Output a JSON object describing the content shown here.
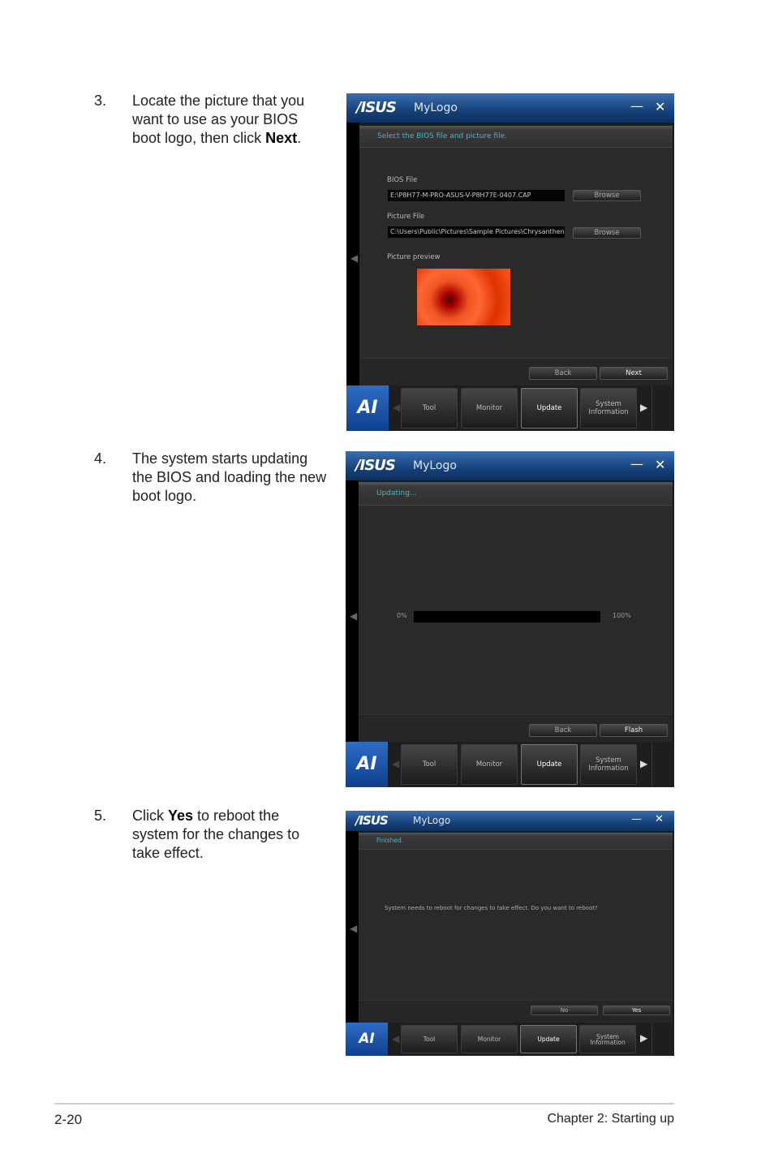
{
  "steps": [
    {
      "num": "3.",
      "parts": [
        "Locate the picture that you want to use as your BIOS boot logo, then click ",
        "Next",
        "."
      ]
    },
    {
      "num": "4.",
      "text": "The system starts updating the BIOS and loading the new boot logo."
    },
    {
      "num": "5.",
      "parts": [
        "Click ",
        "Yes",
        " to reboot the system for the changes to take effect."
      ]
    }
  ],
  "app": {
    "brand": "/ISUS",
    "title": "MyLogo",
    "minimize": "—",
    "close": "✕",
    "ai_logo": "AI",
    "nav": {
      "tabs": [
        "Tool",
        "Monitor",
        "Update",
        "System Information"
      ],
      "active": "Update",
      "left_arrow": "◀",
      "right_arrow": "▶"
    }
  },
  "window1": {
    "header": "Select the BIOS file and picture file.",
    "bios_label": "BIOS File",
    "bios_value": "E:\\P8H77-M-PRO-ASUS-V-P8H77E-0407.CAP",
    "picture_label": "Picture File",
    "picture_value": "C:\\Users\\Public\\Pictures\\Sample Pictures\\Chrysanthen",
    "browse": "Browse",
    "preview_label": "Picture preview",
    "back": "Back",
    "next": "Next"
  },
  "window2": {
    "header": "Updating...",
    "pct_start": "0%",
    "pct_end": "100%",
    "progress": 0,
    "back": "Back",
    "flash": "Flash"
  },
  "window3": {
    "header": "Finished.",
    "message": "System needs to reboot for changes to take effect. Do you want to reboot?",
    "no": "No",
    "yes": "Yes"
  },
  "footer": {
    "page": "2-20",
    "chapter": "Chapter 2: Starting up"
  },
  "colors": {
    "accent": "#3fb6d6",
    "title_bar": "#16417a",
    "ai_logo": "#2f6cc4"
  }
}
